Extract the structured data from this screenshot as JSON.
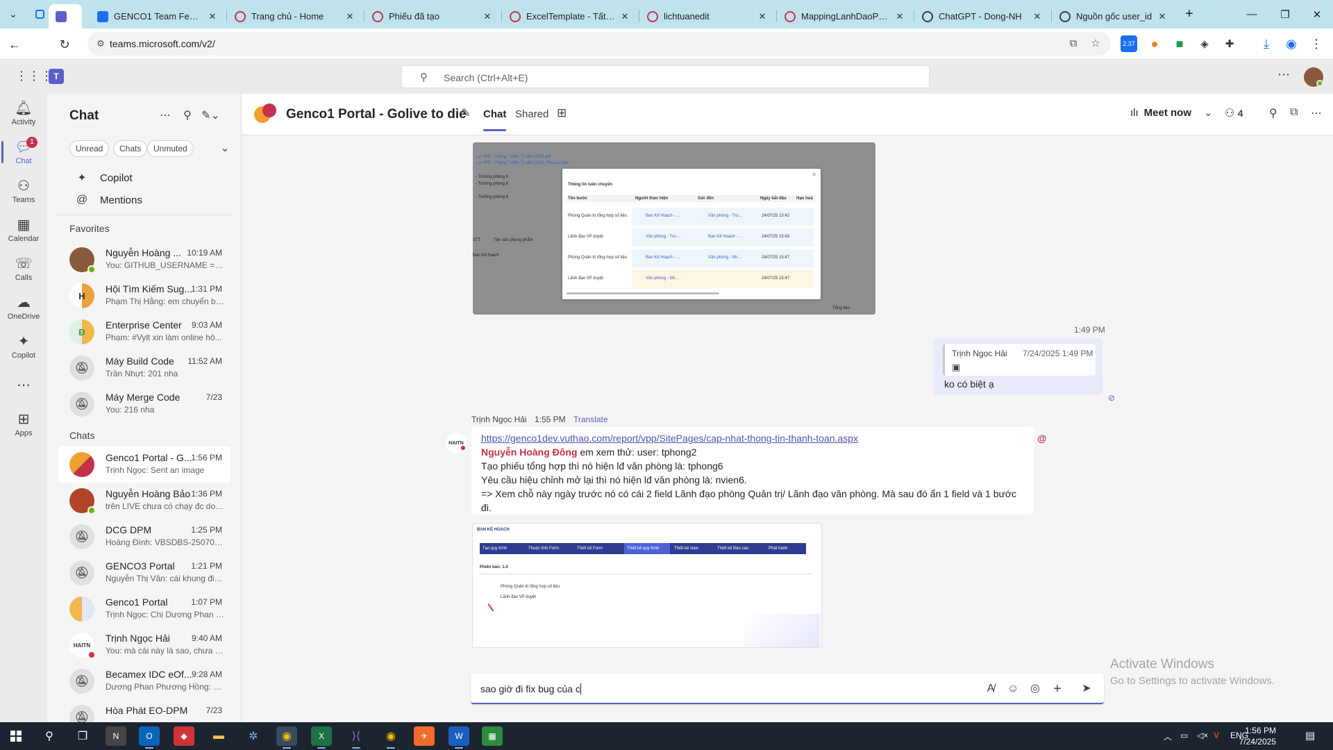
{
  "browser": {
    "tabs": [
      {
        "label": "GENCO1 Team Features",
        "color": "#1b6ef3",
        "active": false
      },
      {
        "label": "Trang chủ - Home",
        "color": "#c4314b",
        "active": false
      },
      {
        "label": "Phiếu đã tạo",
        "color": "#c4314b",
        "active": false
      },
      {
        "label": "ExcelTemplate - Tất cả",
        "color": "#c4314b",
        "active": false
      },
      {
        "label": "lichtuanedit",
        "color": "#c4314b",
        "active": false
      },
      {
        "label": "MappingLanhDaoPhong",
        "color": "#c4314b",
        "active": false
      },
      {
        "label": "ChatGPT - Dong-NH",
        "color": "#3c3c3c",
        "active": false
      },
      {
        "label": "Nguồn gốc user_id",
        "color": "#3c3c3c",
        "active": false
      }
    ],
    "url": "teams.microsoft.com/v2/",
    "ext_badge": "2.37"
  },
  "teams": {
    "search_placeholder": "Search (Ctrl+Alt+E)"
  },
  "rail": {
    "items": [
      {
        "label": "Activity",
        "icon": "bell-icon"
      },
      {
        "label": "Chat",
        "icon": "chat-icon",
        "badge": "1"
      },
      {
        "label": "Teams",
        "icon": "teams-icon"
      },
      {
        "label": "Calendar",
        "icon": "calendar-icon"
      },
      {
        "label": "Calls",
        "icon": "phone-icon"
      },
      {
        "label": "OneDrive",
        "icon": "cloud-icon"
      },
      {
        "label": "Copilot",
        "icon": "copilot-icon"
      },
      {
        "label": "Apps",
        "icon": "apps-icon"
      }
    ]
  },
  "chatlist": {
    "title": "Chat",
    "filters": [
      "Unread",
      "Chats",
      "Unmuted"
    ],
    "nav": [
      {
        "label": "Copilot",
        "icon": "copilot-icon"
      },
      {
        "label": "Mentions",
        "icon": "at-icon"
      }
    ],
    "favorites_label": "Favorites",
    "favorites": [
      {
        "name": "Nguyễn Hoàng ...",
        "time": "10:19 AM",
        "preview": "You: GITHUB_USERNAME = \"n...",
        "avatar": "NH",
        "avatar_color": "#8a5a3c",
        "presence": "#6bb700"
      },
      {
        "name": "Hội Tìm Kiếm Sug...",
        "time": "1:31 PM",
        "preview": "Phạm Thị Hằng: em chuyển bả...",
        "avatar": "H",
        "avatar_color": "#e8a33b",
        "presence": ""
      },
      {
        "name": "Enterprise Center",
        "time": "9:03 AM",
        "preview": "Phạm: #Vylt xin làm online hô...",
        "avatar": "Đ",
        "avatar_color": "#3a9b5c",
        "presence": ""
      },
      {
        "name": "Máy Build Code",
        "time": "11:52 AM",
        "preview": "Trần Nhựt: 201 nha",
        "avatar": "",
        "avatar_color": "#e0e0e0",
        "presence": ""
      },
      {
        "name": "Máy Merge Code",
        "time": "7/23",
        "preview": "You: 216  nha",
        "avatar": "",
        "avatar_color": "#e0e0e0",
        "presence": ""
      }
    ],
    "chats_label": "Chats",
    "chats": [
      {
        "name": "Genco1 Portal - G...",
        "time": "1:56 PM",
        "preview": "Trịnh Ngọc: Sent an image",
        "avatar": "G",
        "avatar_color": "#f0a030",
        "presence": "",
        "active": true
      },
      {
        "name": "Nguyễn Hoàng Bảo",
        "time": "1:36 PM",
        "preview": "trên LIVE chưa có chạy đc do c...",
        "avatar": "NB",
        "avatar_color": "#b0452a",
        "presence": "#6bb700",
        "active": false
      },
      {
        "name": "DCG DPM",
        "time": "1:25 PM",
        "preview": "Hoàng Đình: VBSDBS-2507009...",
        "avatar": "",
        "avatar_color": "#e0e0e0",
        "presence": "",
        "active": false
      },
      {
        "name": "GENCO3 Portal",
        "time": "1:21 PM",
        "preview": "Nguyễn Thị Vân: cái khung điề...",
        "avatar": "",
        "avatar_color": "#e0e0e0",
        "presence": "",
        "active": false
      },
      {
        "name": "Genco1 Portal",
        "time": "1:07 PM",
        "preview": "Trịnh Ngọc: Chị Dương Phan P...",
        "avatar": "G",
        "avatar_color": "#e8a33b",
        "presence": "",
        "active": false
      },
      {
        "name": "Trịnh Ngọc Hải",
        "time": "9:40 AM",
        "preview": "You: mà cái này là sao, chưa hi...",
        "avatar": "HAITN",
        "avatar_color": "#ffffff",
        "presence": "#d13438",
        "active": false
      },
      {
        "name": "Becamex IDC eOf...",
        "time": "9:28 AM",
        "preview": "Dương Phan Phương Hồng: ht...",
        "avatar": "",
        "avatar_color": "#e0e0e0",
        "presence": "",
        "active": false
      },
      {
        "name": "Hòa Phát EO-DPM",
        "time": "7/23",
        "preview": "",
        "avatar": "",
        "avatar_color": "#e0e0e0",
        "presence": "",
        "active": false
      }
    ]
  },
  "main": {
    "title": "Genco1 Portal - Golive to die",
    "tabs": [
      "Chat",
      "Shared"
    ],
    "meet_now": "Meet now",
    "participants": "4",
    "messages": {
      "self_time": "1:49 PM",
      "quote_author": "Trịnh Ngọc Hải",
      "quote_time": "7/24/2025 1:49 PM",
      "self_text": "ko có biệt ạ",
      "sender": "Trịnh Ngọc Hải",
      "sender_time": "1:55 PM",
      "translate": "Translate",
      "link": "https://genco1dev.vuthao.com/report/vpp/SitePages/cap-nhat-thong-tin-thanh-toan.aspx",
      "mention": "Nguyễn Hoàng Đông",
      "line1_rest": " em xem thử: user: tphong2",
      "line2": "Tạo phiếu tổng hợp thì nó hiện lđ văn phòng là: tphong6",
      "line3": "Yêu cầu hiệu chỉnh mở lại thì nó hiện lđ văn phòng là: nvien6.",
      "line4": "=> Xem chỗ này ngày trước nó có cái 2 field Lãnh đạo phòng Quản trị/ Lãnh đạo văn phòng. Mà sau đó ẩn 1 field và 1 bước",
      "line5": "đi.",
      "dialog_title": "Thông tin luân chuyển",
      "dialog_cols": [
        "Tên bước",
        "Người thực hiện",
        "Gửi đến",
        "Ngày bắt đầu",
        "Hạn hoà"
      ],
      "dialog_rows": [
        [
          "Phòng Quản trị tổng hợp số liệu",
          "Ban Kế Hoạch - ...",
          "Văn phòng - Trư...",
          "24/07/25 15:42"
        ],
        [
          "Lãnh đạo VP duyệt",
          "Văn phòng - Trư...",
          "Ban Kế Hoạch - ...",
          "24/07/25 15:43"
        ],
        [
          "Phòng Quản trị tổng hợp số liệu",
          "Ban Kế Hoạch - ...",
          "Văn phòng - Nh...",
          "24/07/25 15:47"
        ],
        [
          "Lãnh đạo VP duyệt",
          "Văn phòng - Nh...",
          "",
          "24/07/25 15:47"
        ]
      ],
      "shot2_title": "BAN KẾ HOẠCH",
      "shot2_steps": [
        "Tạo quy trình",
        "Thuộc tính Form",
        "Thiết kế Form",
        "Thiết kế quy trình",
        "Thiết kế view",
        "Thiết kế Báo cáo",
        "Phát hành"
      ],
      "shot2_version": "Phiên bản: 1.0",
      "shot2_rows": [
        "Phòng Quản trị tổng hợp số liệu",
        "Lãnh đạo VP duyệt"
      ]
    },
    "compose_text": "sao giờ đi fix bug của c"
  },
  "watermark": {
    "line1": "Activate Windows",
    "line2": "Go to Settings to activate Windows."
  },
  "taskbar": {
    "lang": "ENG",
    "time": "1:56 PM",
    "date": "7/24/2025"
  }
}
